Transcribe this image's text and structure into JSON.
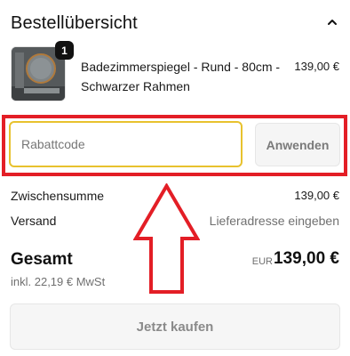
{
  "header": {
    "title": "Bestellübersicht",
    "collapse_icon": "chevron-up-icon"
  },
  "product": {
    "quantity": "1",
    "name": "Badezimmerspiegel - Rund - 80cm - Schwarzer Rahmen",
    "price": "139,00 €"
  },
  "discount": {
    "placeholder": "Rabattcode",
    "apply_label": "Anwenden"
  },
  "summary": {
    "subtotal_label": "Zwischensumme",
    "subtotal_value": "139,00 €",
    "shipping_label": "Versand",
    "shipping_value": "Lieferadresse eingeben"
  },
  "total": {
    "label": "Gesamt",
    "currency": "EUR",
    "value": "139,00 €",
    "tax_note": "inkl. 22,19 € MwSt"
  },
  "checkout": {
    "buy_label": "Jetzt kaufen"
  },
  "colors": {
    "highlight": "#e31e26",
    "input_focus": "#e8c22e"
  }
}
